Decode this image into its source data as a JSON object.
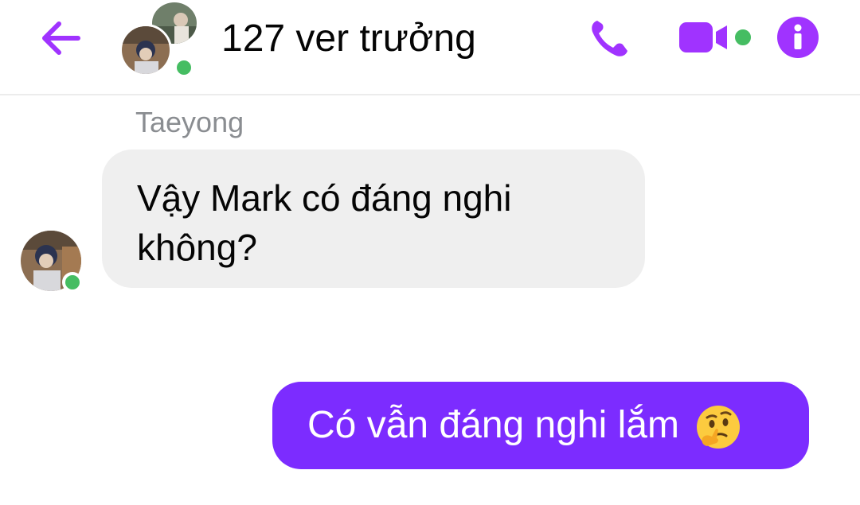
{
  "header": {
    "title": "127 ver trưởng",
    "accent_color": "#a033ff",
    "presence_color": "#45bd62"
  },
  "icons": {
    "back": "back-arrow-icon",
    "call": "phone-icon",
    "video": "video-camera-icon",
    "info": "info-icon"
  },
  "messages": [
    {
      "sender": "Taeyong",
      "text": "Vậy Mark có đáng nghi không?",
      "direction": "incoming"
    },
    {
      "text": "Có vẫn đáng nghi lắm",
      "emoji": "thinking-face",
      "direction": "outgoing"
    }
  ],
  "colors": {
    "incoming_bubble": "#efefef",
    "outgoing_bubble": "#7c2cff"
  }
}
